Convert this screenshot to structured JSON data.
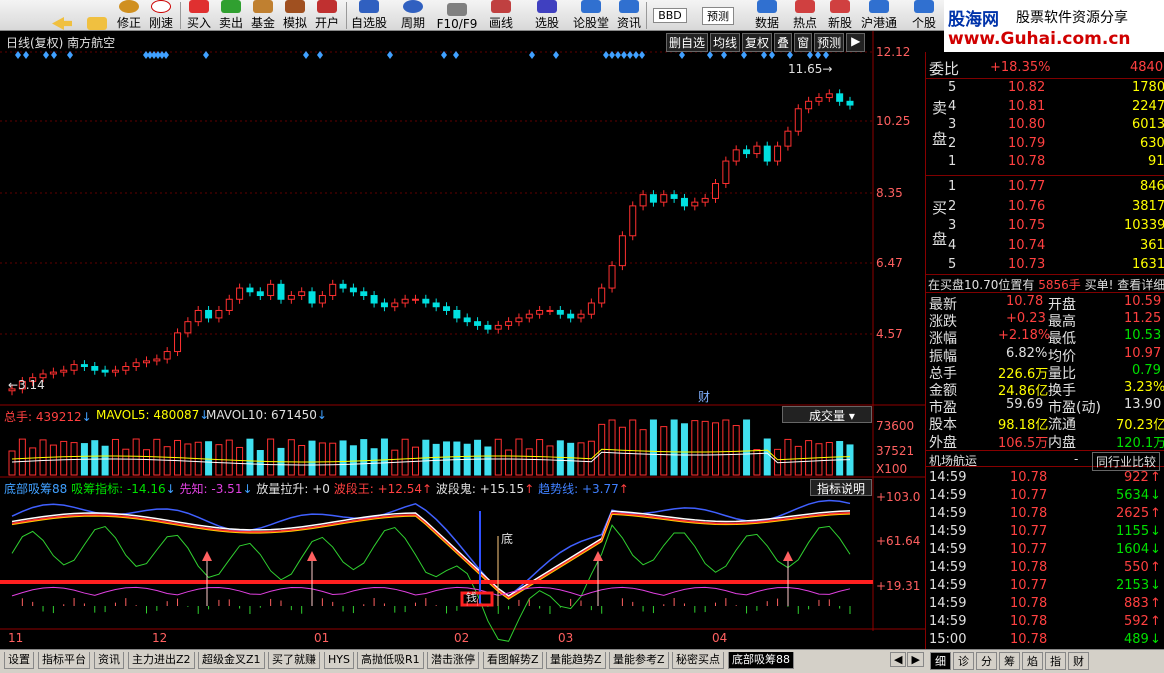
{
  "toolbar": {
    "buttons": [
      "修正",
      "刚速",
      "买入",
      "卖出",
      "基金",
      "模拟",
      "开户",
      "自选股",
      "周期",
      "F10/F9",
      "画线",
      "选股",
      "论股堂",
      "资讯",
      "数据",
      "热点",
      "新股",
      "沪港通"
    ],
    "upper_buttons": [
      "BBD",
      "预测"
    ],
    "last_partial": "个股"
  },
  "logo": {
    "name": "股海网",
    "slogan": "股票软件资源分享",
    "url": "www.Guhai.com.cn"
  },
  "main_chart": {
    "title": "日线(复权) 南方航空",
    "buttons": [
      "删自选",
      "均线",
      "复权",
      "叠",
      "窗",
      "预测"
    ],
    "y_labels": [
      "12.12",
      "10.25",
      "8.35",
      "6.47",
      "4.57"
    ],
    "high_label": "11.65",
    "low_label": "3.14",
    "marker": "财"
  },
  "volume_panel": {
    "total_label": "总手: 439212",
    "mavol5_label": "MAVOL5: 480087",
    "mavol10_label": "MAVOL10: 671450",
    "selector": "成交量",
    "y_labels": [
      "73600",
      "37521",
      "X100"
    ]
  },
  "indicator_panel": {
    "name": "底部吸筹88",
    "items": [
      {
        "label": "吸筹指标: -14.16",
        "color": "#00e000"
      },
      {
        "label": "先知: -3.51",
        "color": "#e040e0"
      },
      {
        "label": "放量拉升: +0",
        "color": "#e0e0e0"
      },
      {
        "label": "波段王: +12.54",
        "color": "#ff4040"
      },
      {
        "label": "波段鬼: +15.15",
        "color": "#e0e0e0"
      },
      {
        "label": "趋势线: +3.77",
        "color": "#4080ff"
      }
    ],
    "help_button": "指标说明",
    "y_labels": [
      "+103.0",
      "+61.64",
      "+19.31"
    ],
    "bottom_label": "底",
    "sign_label": "钱"
  },
  "x_axis": {
    "labels": [
      "11",
      "12",
      "01",
      "02",
      "03",
      "04"
    ]
  },
  "right_panel": {
    "weibi_label": "委比",
    "weibi_value": "+18.35%",
    "weibi_diff": "4840",
    "sell_label": "卖盘",
    "buy_label": "买盘",
    "sells": [
      {
        "lvl": "5",
        "price": "10.82",
        "vol": "1780"
      },
      {
        "lvl": "4",
        "price": "10.81",
        "vol": "2247"
      },
      {
        "lvl": "3",
        "price": "10.80",
        "vol": "6013"
      },
      {
        "lvl": "2",
        "price": "10.79",
        "vol": "630"
      },
      {
        "lvl": "1",
        "price": "10.78",
        "vol": "91"
      }
    ],
    "buys": [
      {
        "lvl": "1",
        "price": "10.77",
        "vol": "846"
      },
      {
        "lvl": "2",
        "price": "10.76",
        "vol": "3817"
      },
      {
        "lvl": "3",
        "price": "10.75",
        "vol": "10339"
      },
      {
        "lvl": "4",
        "price": "10.74",
        "vol": "361"
      },
      {
        "lvl": "5",
        "price": "10.73",
        "vol": "1631"
      }
    ],
    "notice": "在买盘10.70位置有",
    "notice_vol": "5856手",
    "notice_tail": "买单! 查看详细",
    "stats": [
      {
        "k1": "最新",
        "v1": "10.78",
        "c1": "red",
        "k2": "开盘",
        "v2": "10.59",
        "c2": "red"
      },
      {
        "k1": "涨跌",
        "v1": "+0.23",
        "c1": "red",
        "k2": "最高",
        "v2": "11.25",
        "c2": "red"
      },
      {
        "k1": "涨幅",
        "v1": "+2.18%",
        "c1": "red",
        "k2": "最低",
        "v2": "10.53",
        "c2": "green"
      },
      {
        "k1": "振幅",
        "v1": "6.82%",
        "c1": "white",
        "k2": "均价",
        "v2": "10.97",
        "c2": "red"
      },
      {
        "k1": "总手",
        "v1": "226.6万",
        "c1": "yellow",
        "k2": "量比",
        "v2": "0.79",
        "c2": "green"
      },
      {
        "k1": "金额",
        "v1": "24.86亿",
        "c1": "yellow",
        "k2": "换手",
        "v2": "3.23%",
        "c2": "yellow"
      },
      {
        "k1": "市盈",
        "v1": "59.69",
        "c1": "white",
        "k2": "市盈(动)",
        "v2": "13.90",
        "c2": "white"
      },
      {
        "k1": "股本",
        "v1": "98.18亿",
        "c1": "yellow",
        "k2": "流通",
        "v2": "70.23亿",
        "c2": "yellow"
      },
      {
        "k1": "外盘",
        "v1": "106.5万",
        "c1": "red",
        "k2": "内盘",
        "v2": "120.1万",
        "c2": "green"
      }
    ],
    "sector": "机场航运",
    "sector_btn": "同行业比较",
    "ticks": [
      {
        "time": "14:59",
        "price": "10.78",
        "vol": "922",
        "dir": "up"
      },
      {
        "time": "14:59",
        "price": "10.77",
        "vol": "5634",
        "dir": "down"
      },
      {
        "time": "14:59",
        "price": "10.78",
        "vol": "2625",
        "dir": "up"
      },
      {
        "time": "14:59",
        "price": "10.77",
        "vol": "1155",
        "dir": "down"
      },
      {
        "time": "14:59",
        "price": "10.77",
        "vol": "1604",
        "dir": "down"
      },
      {
        "time": "14:59",
        "price": "10.78",
        "vol": "550",
        "dir": "up"
      },
      {
        "time": "14:59",
        "price": "10.77",
        "vol": "2153",
        "dir": "down"
      },
      {
        "time": "14:59",
        "price": "10.78",
        "vol": "883",
        "dir": "up"
      },
      {
        "time": "14:59",
        "price": "10.78",
        "vol": "592",
        "dir": "up"
      },
      {
        "time": "15:00",
        "price": "10.78",
        "vol": "489",
        "dir": "down"
      }
    ],
    "bottom_tabs": [
      "细",
      "诊",
      "分",
      "筹",
      "焰",
      "指",
      "财"
    ]
  },
  "tabs": [
    "设置",
    "指标平台",
    "资讯",
    "主力进出Z2",
    "超级金叉Z1",
    "买了就赚",
    "HYS",
    "高抛低吸R1",
    "潜击涨停",
    "看图解势Z",
    "量能趋势Z",
    "量能参考Z",
    "秘密买点",
    "底部吸筹88"
  ],
  "candles": [
    3.1,
    3.3,
    3.4,
    3.5,
    3.55,
    3.6,
    3.75,
    3.7,
    3.6,
    3.55,
    3.6,
    3.7,
    3.8,
    3.85,
    3.9,
    4.1,
    4.6,
    4.9,
    5.2,
    5.0,
    5.2,
    5.5,
    5.8,
    5.7,
    5.6,
    5.9,
    5.5,
    5.6,
    5.7,
    5.4,
    5.6,
    5.9,
    5.8,
    5.7,
    5.6,
    5.4,
    5.3,
    5.4,
    5.5,
    5.5,
    5.4,
    5.3,
    5.2,
    5.0,
    4.9,
    4.8,
    4.7,
    4.8,
    4.9,
    5.0,
    5.1,
    5.2,
    5.2,
    5.1,
    5.0,
    5.1,
    5.4,
    5.8,
    6.4,
    7.2,
    8.0,
    8.3,
    8.1,
    8.3,
    8.2,
    8.0,
    8.1,
    8.2,
    8.6,
    9.2,
    9.5,
    9.4,
    9.6,
    9.2,
    9.6,
    10.0,
    10.6,
    10.8,
    10.9,
    11.0,
    10.8,
    10.7
  ]
}
